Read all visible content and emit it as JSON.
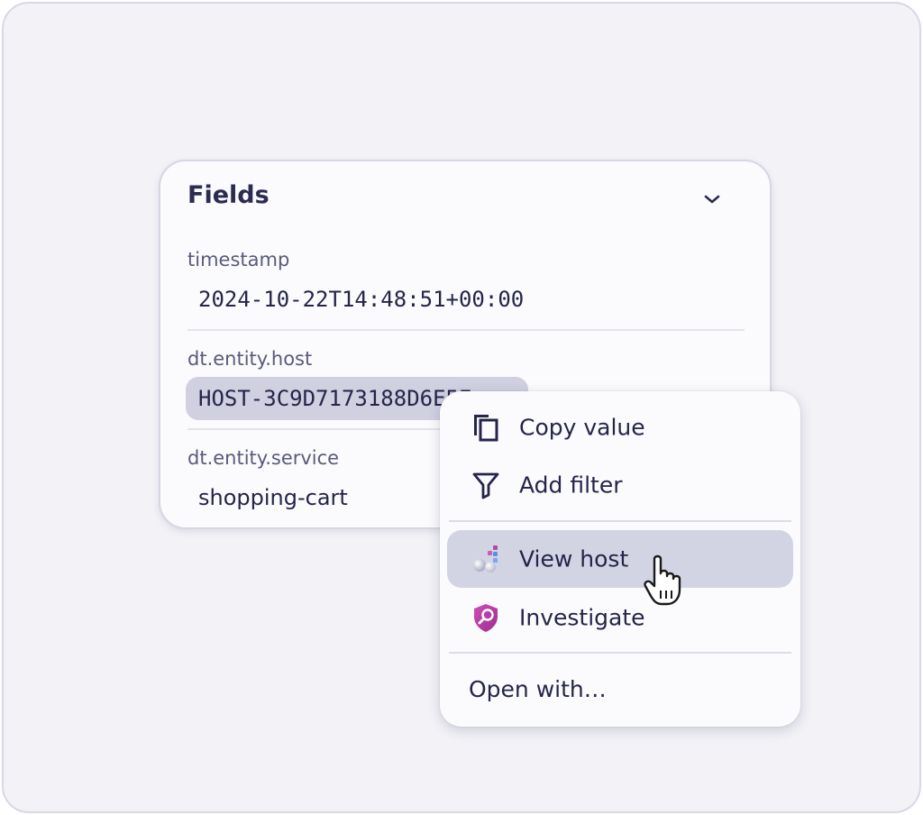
{
  "fields_panel": {
    "title": "Fields",
    "items": [
      {
        "label": "timestamp",
        "value": "2024-10-22T14:48:51+00:00"
      },
      {
        "label": "dt.entity.host",
        "value": "HOST-3C9D7173188D6E5E"
      },
      {
        "label": "dt.entity.service",
        "value": "shopping-cart"
      }
    ],
    "collapse_icon": "chevron-down-icon"
  },
  "context_menu": {
    "items": [
      {
        "label": "Copy value",
        "icon": "copy-icon"
      },
      {
        "label": "Add filter",
        "icon": "filter-icon"
      },
      {
        "label": "View host",
        "icon": "hosts-app-icon",
        "highlighted": true
      },
      {
        "label": "Investigate",
        "icon": "investigate-shield-icon"
      }
    ],
    "open_with_label": "Open with…"
  },
  "colors": {
    "background": "#f2f2f7",
    "card": "#fbfbfd",
    "text": "#25254a",
    "highlight": "#d3d4e3",
    "host_pill": "#d0d0e0",
    "investigate_icon": "#b2389f"
  },
  "cursor": "hand-pointer-cursor"
}
